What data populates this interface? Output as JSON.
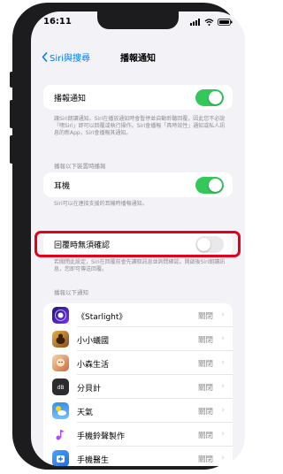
{
  "status_bar": {
    "time": "16:11"
  },
  "nav": {
    "back_label": "Siri與搜尋",
    "title": "播報通知"
  },
  "announce": {
    "label": "播報通知",
    "enabled": true
  },
  "announce_footnote": "讓Siri朗讀通知。Siri在播放通知時會暫停並自動聆聽回覆，因此您不必說「嘿Siri」即可以回覆或執行操作。Siri會播報「具時效性」通知或私人訊息的新App，Siri會播報其通知。",
  "devices_header": "播報以下裝置時播報",
  "headphones": {
    "label": "耳機",
    "enabled": true
  },
  "headphones_footnote": "Siri可以在連接支援的耳機時播報通知。",
  "reply_confirm": {
    "label": "回覆時無須確認",
    "enabled": false
  },
  "reply_footnote": "若關閉此設定，Siri在回覆前會先讀取訊息並詢問確認。開啟後Siri朗讀訊息，您即可傳送回覆。",
  "apps_header": "播報以下通知",
  "apps": [
    {
      "name": "《Starlight》",
      "status": "關閉",
      "icon": "starlight-app-icon"
    },
    {
      "name": "小小蟻國",
      "status": "關閉",
      "icon": "ant-kingdom-app-icon"
    },
    {
      "name": "小森生活",
      "status": "關閉",
      "icon": "forest-life-app-icon"
    },
    {
      "name": "分貝計",
      "status": "關閉",
      "icon": "decibel-meter-app-icon"
    },
    {
      "name": "天氣",
      "status": "關閉",
      "icon": "weather-app-icon"
    },
    {
      "name": "手機鈴聲製作",
      "status": "關閉",
      "icon": "ringtone-maker-app-icon"
    },
    {
      "name": "手機醫生",
      "status": "關閉",
      "icon": "phone-doctor-app-icon"
    }
  ],
  "colors": {
    "accent": "#007aff",
    "toggle_on": "#34c759",
    "highlight": "#e4001b"
  }
}
